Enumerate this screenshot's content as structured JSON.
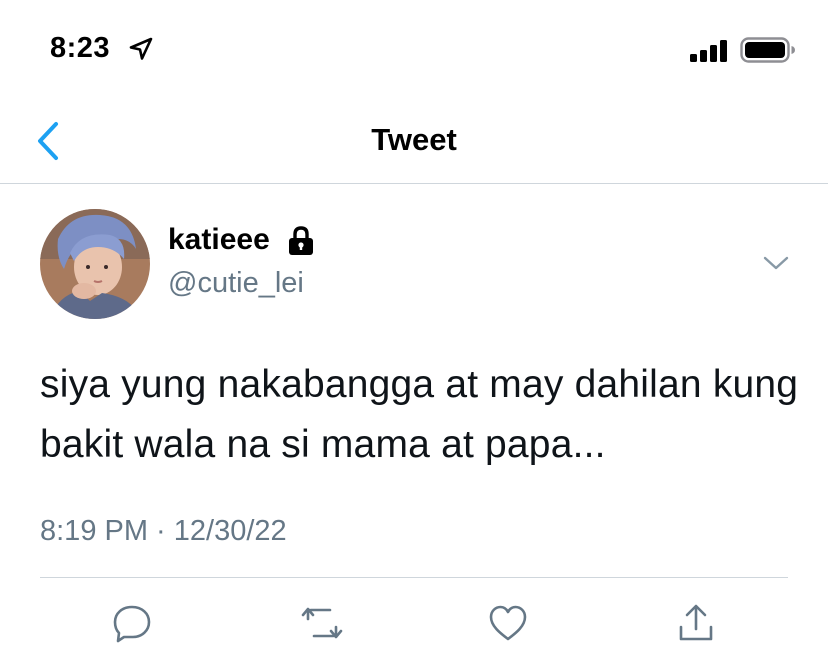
{
  "status_bar": {
    "time": "8:23",
    "icons": [
      "location-arrow-icon",
      "signal-icon",
      "battery-icon"
    ]
  },
  "nav": {
    "title": "Tweet",
    "back_icon": "chevron-left-icon",
    "accent_color": "#1da1f2"
  },
  "tweet": {
    "display_name": "katieee",
    "protected_icon": "lock-icon",
    "handle": "@cutie_lei",
    "text": "siya yung nakabangga at may dahilan kung bakit wala na si mama at papa...",
    "timestamp": "8:19 PM · 12/30/22",
    "caret_icon": "chevron-down-icon"
  },
  "actions": [
    "reply-icon",
    "retweet-icon",
    "like-icon",
    "share-icon"
  ],
  "colors": {
    "text": "#0f1419",
    "secondary": "#657786",
    "accent": "#1da1f2",
    "divider": "#cfd6dc"
  }
}
